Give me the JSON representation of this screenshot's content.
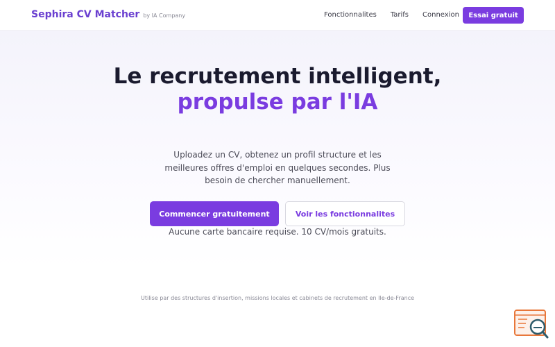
{
  "nav": {
    "brand": "Sephira CV Matcher",
    "brand_sub": "by IA Company",
    "links": [
      "Fonctionnalites",
      "Tarifs",
      "Connexion"
    ],
    "cta": "Essai gratuit"
  },
  "hero": {
    "headline_part1": "Le recrutement intelligent,",
    "headline_accent": "propulse par l'IA",
    "subtext": "Uploadez un CV, obtenez un profil structure et les meilleures offres d'emploi en quelques secondes. Plus besoin de chercher manuellement.",
    "primary_button": "Commencer gratuitement",
    "secondary_button": "Voir les fonctionnalites",
    "note": "Aucune carte bancaire requise. 10 CV/mois gratuits."
  },
  "trust_line": "Utilise par des structures d'insertion, missions locales et cabinets de recrutement en Ile-de-France",
  "widget": {
    "icon": "search-document-icon"
  },
  "colors": {
    "brand": "#6a3fd0",
    "accent": "#7a3ce0",
    "widget_orange": "#e8773a",
    "widget_teal": "#2d5c6c"
  }
}
